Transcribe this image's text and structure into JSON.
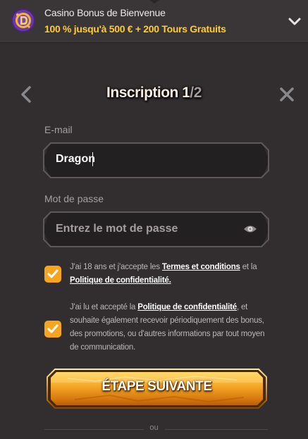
{
  "banner": {
    "title": "Casino Bonus de Bienvenue",
    "offer": "100 % jusqu'à 500 € + 200 Tours Gratuits",
    "logo_icon": "dragon-coin-logo",
    "expand_icon": "chevron-down-icon"
  },
  "modal": {
    "title_main": "Inscription 1",
    "title_sep": "/",
    "title_total": "2",
    "back_icon": "chevron-left-icon",
    "close_icon": "close-icon"
  },
  "form": {
    "email": {
      "label": "E-mail",
      "value": "Dragon"
    },
    "password": {
      "label": "Mot de passe",
      "placeholder": "Entrez le mot de passe",
      "toggle_icon": "eye-icon"
    }
  },
  "consents": [
    {
      "checked": true,
      "text_before": "J'ai 18 ans et j'accepte les ",
      "link1": "Termes et conditions",
      "text_middle": " et la ",
      "link2": "Politique de confidentialité."
    },
    {
      "checked": true,
      "text_before": "J'ai lu et accepté la ",
      "link1": "Politique de confidentialité",
      "text_after": ", et souhaite également recevoir périodiquement des bonus, des promotions, ou d'autres informations par tout moyen de communication."
    }
  ],
  "actions": {
    "next_label": "ÉTAPE SUIVANTE",
    "divider_label": "ou"
  },
  "colors": {
    "background": "#322d2f",
    "accent": "#f7a51f",
    "offer_text": "#ffcc33"
  }
}
